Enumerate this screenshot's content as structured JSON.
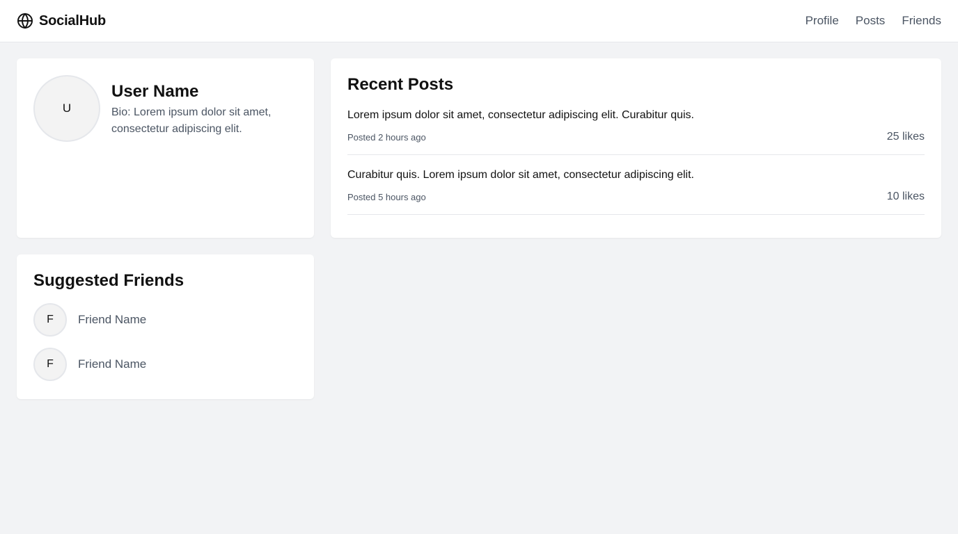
{
  "header": {
    "brand": "SocialHub",
    "brand_icon": "globe-icon",
    "nav": [
      "Profile",
      "Posts",
      "Friends"
    ]
  },
  "profile": {
    "avatar_initial": "U",
    "name": "User Name",
    "bio": "Bio: Lorem ipsum dolor sit amet, consectetur adipiscing elit."
  },
  "posts": {
    "title": "Recent Posts",
    "items": [
      {
        "text": "Lorem ipsum dolor sit amet, consectetur adipiscing elit. Curabitur quis.",
        "time": "Posted 2 hours ago",
        "likes": "25 likes"
      },
      {
        "text": "Curabitur quis. Lorem ipsum dolor sit amet, consectetur adipiscing elit.",
        "time": "Posted 5 hours ago",
        "likes": "10 likes"
      }
    ]
  },
  "friends": {
    "title": "Suggested Friends",
    "items": [
      {
        "initial": "F",
        "name": "Friend Name"
      },
      {
        "initial": "F",
        "name": "Friend Name"
      }
    ]
  },
  "colors": {
    "background": "#f2f3f5",
    "card": "#ffffff",
    "muted_text": "#4b5563",
    "border": "#e5e7eb"
  }
}
